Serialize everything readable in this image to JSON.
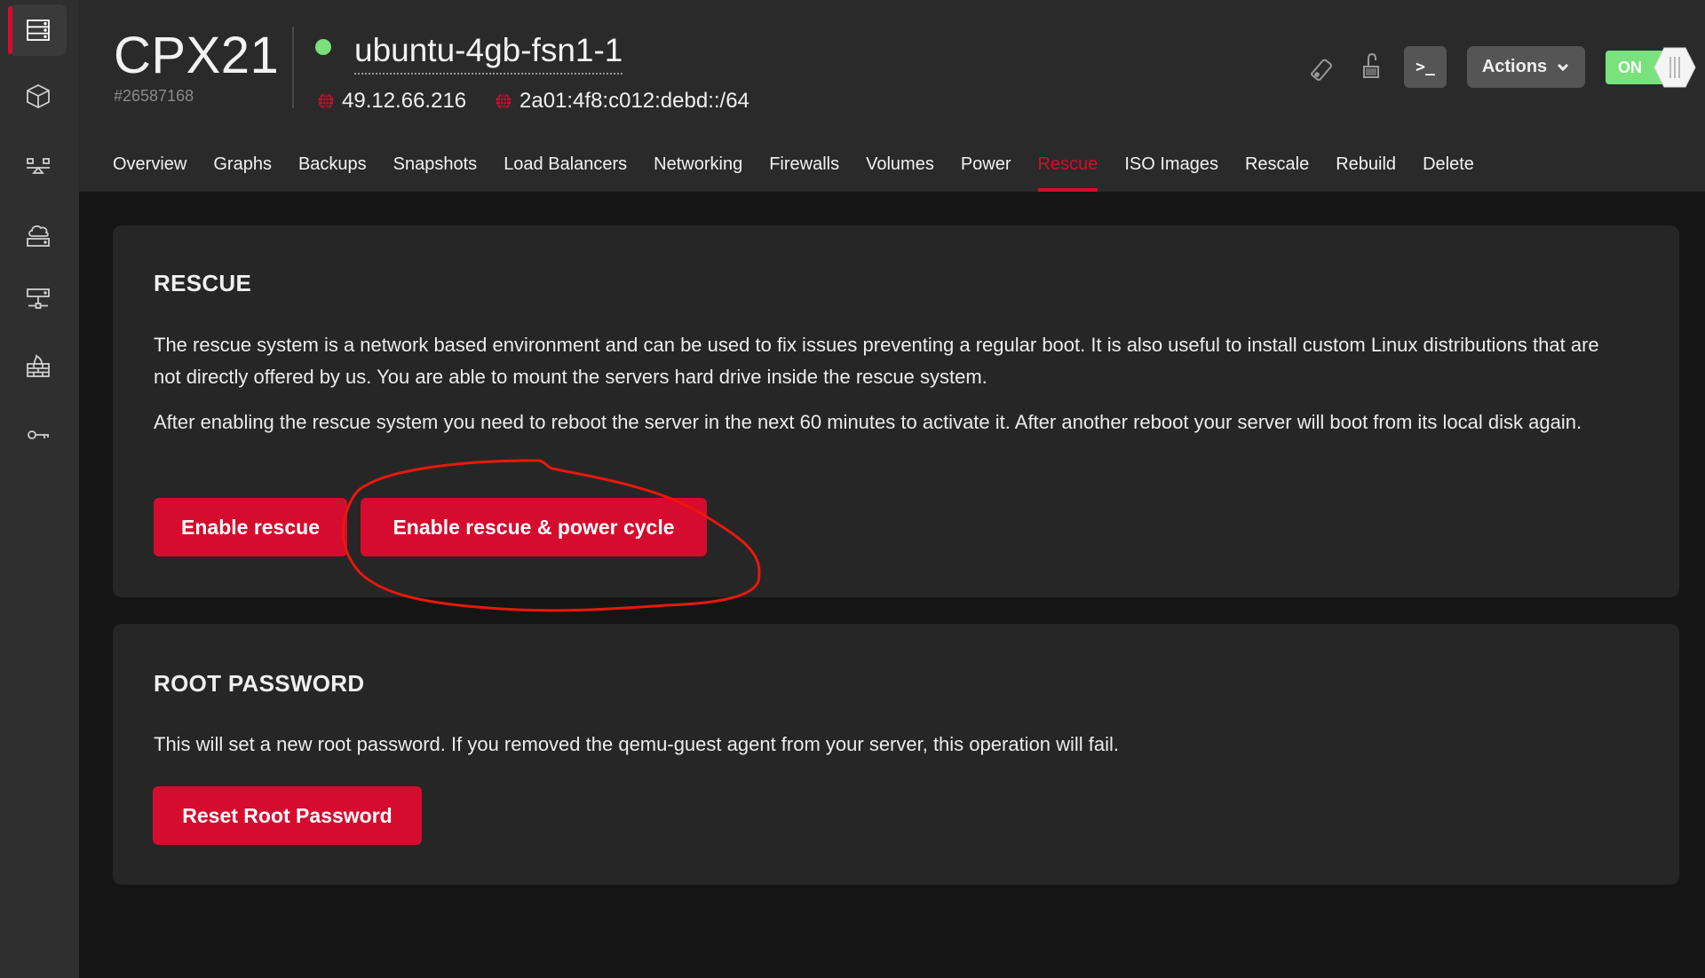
{
  "sidebar": {
    "items": [
      {
        "name": "servers",
        "icon": "server-icon",
        "active": true
      },
      {
        "name": "volumes",
        "icon": "cube-icon",
        "active": false
      },
      {
        "name": "load-balancers",
        "icon": "load-balancer-icon",
        "active": false
      },
      {
        "name": "floating-ips",
        "icon": "cloud-server-icon",
        "active": false
      },
      {
        "name": "networks",
        "icon": "network-icon",
        "active": false
      },
      {
        "name": "firewalls",
        "icon": "firewall-icon",
        "active": false
      },
      {
        "name": "security",
        "icon": "key-icon",
        "active": false
      }
    ]
  },
  "header": {
    "server_type": "CPX21",
    "server_id": "#26587168",
    "server_name": "ubuntu-4gb-fsn1-1",
    "status": "running",
    "status_color": "#7be07c",
    "ipv4": "49.12.66.216",
    "ipv6": "2a01:4f8:c012:debd::/64",
    "console_label": ">_",
    "actions_label": "Actions",
    "power_label": "ON",
    "power_on": true
  },
  "tabs": [
    {
      "label": "Overview",
      "active": false
    },
    {
      "label": "Graphs",
      "active": false
    },
    {
      "label": "Backups",
      "active": false
    },
    {
      "label": "Snapshots",
      "active": false
    },
    {
      "label": "Load Balancers",
      "active": false
    },
    {
      "label": "Networking",
      "active": false
    },
    {
      "label": "Firewalls",
      "active": false
    },
    {
      "label": "Volumes",
      "active": false
    },
    {
      "label": "Power",
      "active": false
    },
    {
      "label": "Rescue",
      "active": true
    },
    {
      "label": "ISO Images",
      "active": false
    },
    {
      "label": "Rescale",
      "active": false
    },
    {
      "label": "Rebuild",
      "active": false
    },
    {
      "label": "Delete",
      "active": false
    }
  ],
  "rescue": {
    "title": "RESCUE",
    "paragraph1": "The rescue system is a network based environment and can be used to fix issues preventing a regular boot. It is also useful to install custom Linux distributions that are not directly offered by us. You are able to mount the servers hard drive inside the rescue system.",
    "paragraph2": "After enabling the rescue system you need to reboot the server in the next 60 minutes to activate it. After another reboot your server will boot from its local disk again.",
    "enable_button": "Enable rescue",
    "enable_cycle_button": "Enable rescue & power cycle"
  },
  "root_password": {
    "title": "ROOT PASSWORD",
    "description": "This will set a new root password. If you removed the qemu-guest agent from your server, this operation will fail.",
    "reset_button": "Reset Root Password"
  },
  "colors": {
    "accent": "#d50c2d",
    "status_on": "#79e27c",
    "annotation": "#e8180c"
  }
}
